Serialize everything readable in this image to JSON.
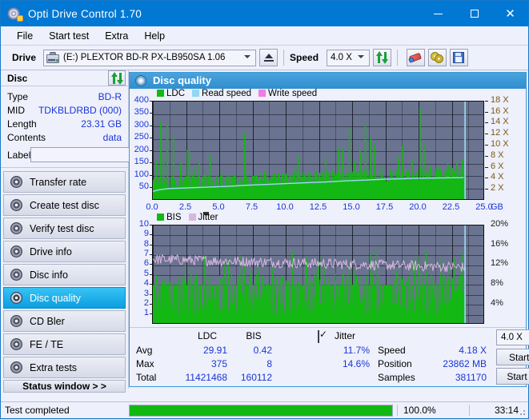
{
  "window": {
    "title": "Opti Drive Control 1.70",
    "icon": "disc-icon",
    "minimize": "–",
    "maximize": "□",
    "close": "✕"
  },
  "menu": [
    {
      "label": "File"
    },
    {
      "label": "Start test"
    },
    {
      "label": "Extra"
    },
    {
      "label": "Help"
    }
  ],
  "toolbar": {
    "drive_label": "Drive",
    "drive_value": "(E:)   PLEXTOR BD-R  PX-LB950SA 1.06",
    "eject_icon": "eject-icon",
    "speed_label": "Speed",
    "speed_value": "4.0 X",
    "icons": [
      "refresh-icon",
      "eraser-icon",
      "discs-icon",
      "save-icon"
    ]
  },
  "disc": {
    "header": "Disc",
    "refresh_icon": "refresh-icon",
    "fields": [
      {
        "key": "Type",
        "value": "BD-R"
      },
      {
        "key": "MID",
        "value": "TDKBLDRBD (000)"
      },
      {
        "key": "Length",
        "value": "23.31 GB"
      },
      {
        "key": "Contents",
        "value": "data"
      }
    ],
    "label_key": "Label",
    "label_value": "",
    "label_placeholder": "",
    "cd_icon": "cd-icon"
  },
  "sidebar": {
    "items": [
      {
        "label": "Transfer rate",
        "selected": false
      },
      {
        "label": "Create test disc",
        "selected": false
      },
      {
        "label": "Verify test disc",
        "selected": false
      },
      {
        "label": "Drive info",
        "selected": false
      },
      {
        "label": "Disc info",
        "selected": false
      },
      {
        "label": "Disc quality",
        "selected": true
      },
      {
        "label": "CD Bler",
        "selected": false
      },
      {
        "label": "FE / TE",
        "selected": false
      },
      {
        "label": "Extra tests",
        "selected": false
      }
    ],
    "status_window": "Status window > >"
  },
  "panel": {
    "title": "Disc quality",
    "icon": "disc-quality-icon"
  },
  "chart_data": [
    {
      "type": "area",
      "title": "LDC",
      "xlabel": "GB",
      "ylabel": "LDC",
      "xlim": [
        0,
        25
      ],
      "ylim": [
        0,
        400
      ],
      "y2lim": [
        0,
        18
      ],
      "y2label": "X",
      "grid": true,
      "legend": [
        "LDC",
        "Read speed",
        "Write speed"
      ],
      "legend_colors": [
        "#14b814",
        "#8fd8f4",
        "#f47ae0"
      ],
      "xticks": [
        "0.0",
        "2.5",
        "5.0",
        "7.5",
        "10.0",
        "12.5",
        "15.0",
        "17.5",
        "20.0",
        "22.5",
        "25.0"
      ],
      "yticks": [
        "50",
        "100",
        "150",
        "200",
        "250",
        "300",
        "350",
        "400"
      ],
      "y2ticks": [
        "2 X",
        "4 X",
        "6 X",
        "8 X",
        "10 X",
        "12 X",
        "14 X",
        "16 X",
        "18 X"
      ],
      "data_end_gb": 23.5,
      "series": [
        {
          "name": "LDC",
          "color": "#14b814",
          "baseline": [
            78,
            72,
            64,
            60,
            58,
            56,
            55,
            54,
            53,
            52,
            52,
            51,
            51,
            50,
            50,
            50,
            50,
            50,
            50,
            51,
            51,
            52,
            52,
            53,
            53,
            54,
            54,
            55,
            55,
            56,
            56,
            57,
            57,
            58,
            58,
            59,
            59,
            60,
            60,
            61,
            61,
            62,
            62,
            63,
            63,
            64,
            64,
            65,
            65,
            66,
            66,
            67,
            67,
            68,
            68,
            69,
            69,
            70,
            70,
            71,
            71,
            72,
            72,
            73,
            73,
            74,
            74,
            75,
            75,
            76,
            76,
            77,
            77,
            78,
            78,
            79,
            79,
            80,
            80,
            81,
            81,
            82,
            82,
            83,
            83,
            84,
            84,
            85,
            85,
            86,
            86,
            87,
            87,
            88,
            88,
            89,
            89,
            90,
            90,
            91
          ],
          "spikes": [
            {
              "x": 0.25,
              "y": 160
            },
            {
              "x": 0.6,
              "y": 320
            },
            {
              "x": 0.8,
              "y": 190
            },
            {
              "x": 1.1,
              "y": 305
            },
            {
              "x": 1.55,
              "y": 260
            },
            {
              "x": 2.1,
              "y": 150
            },
            {
              "x": 2.6,
              "y": 205
            },
            {
              "x": 2.75,
              "y": 200
            },
            {
              "x": 3.1,
              "y": 130
            },
            {
              "x": 3.5,
              "y": 155
            },
            {
              "x": 3.95,
              "y": 110
            },
            {
              "x": 4.3,
              "y": 188
            },
            {
              "x": 5.15,
              "y": 120
            },
            {
              "x": 5.6,
              "y": 95
            },
            {
              "x": 6.2,
              "y": 105
            },
            {
              "x": 6.9,
              "y": 275
            },
            {
              "x": 7.6,
              "y": 100
            },
            {
              "x": 8.4,
              "y": 120
            },
            {
              "x": 9.1,
              "y": 95
            },
            {
              "x": 9.8,
              "y": 110
            },
            {
              "x": 10.6,
              "y": 130
            },
            {
              "x": 11.0,
              "y": 180
            },
            {
              "x": 11.4,
              "y": 105
            },
            {
              "x": 12.3,
              "y": 120
            },
            {
              "x": 13.0,
              "y": 175
            },
            {
              "x": 13.5,
              "y": 125
            },
            {
              "x": 14.0,
              "y": 215
            },
            {
              "x": 14.3,
              "y": 210
            },
            {
              "x": 14.8,
              "y": 295
            },
            {
              "x": 15.2,
              "y": 160
            },
            {
              "x": 15.6,
              "y": 200
            },
            {
              "x": 16.0,
              "y": 310
            },
            {
              "x": 16.4,
              "y": 255
            },
            {
              "x": 16.7,
              "y": 220
            },
            {
              "x": 17.2,
              "y": 145
            },
            {
              "x": 17.9,
              "y": 125
            },
            {
              "x": 18.5,
              "y": 175
            },
            {
              "x": 18.8,
              "y": 220
            },
            {
              "x": 19.5,
              "y": 165
            },
            {
              "x": 20.1,
              "y": 375
            },
            {
              "x": 20.4,
              "y": 225
            },
            {
              "x": 20.9,
              "y": 140
            },
            {
              "x": 21.6,
              "y": 135
            },
            {
              "x": 22.2,
              "y": 150
            },
            {
              "x": 22.9,
              "y": 155
            },
            {
              "x": 23.3,
              "y": 165
            }
          ]
        },
        {
          "name": "Read speed",
          "color": "#9bdcf7",
          "points": [
            [
              0,
              1.7
            ],
            [
              0.5,
              2.0
            ],
            [
              1.2,
              2.2
            ],
            [
              2.3,
              2.3
            ],
            [
              3.3,
              2.4
            ],
            [
              4.4,
              2.5
            ],
            [
              5.6,
              2.6
            ],
            [
              7.0,
              2.8
            ],
            [
              8.5,
              2.95
            ],
            [
              10.0,
              3.1
            ],
            [
              11.5,
              3.25
            ],
            [
              13.0,
              3.4
            ],
            [
              14.5,
              3.6
            ],
            [
              16.0,
              3.75
            ],
            [
              17.5,
              3.9
            ],
            [
              19.0,
              4.0
            ],
            [
              20.5,
              4.1
            ],
            [
              22.0,
              4.15
            ],
            [
              23.4,
              4.18
            ]
          ]
        }
      ]
    },
    {
      "type": "area",
      "title": "BIS",
      "xlabel": "GB",
      "ylabel": "BIS",
      "xlim": [
        0,
        25
      ],
      "ylim": [
        0,
        10
      ],
      "y2lim": [
        0,
        20
      ],
      "y2label": "%",
      "grid": true,
      "legend": [
        "BIS",
        "Jitter"
      ],
      "legend_colors": [
        "#14b814",
        "#d8b6e0"
      ],
      "xticks": [
        "0.0",
        "2.5",
        "5.0",
        "7.5",
        "10.0",
        "12.5",
        "15.0",
        "17.5",
        "20.0",
        "22.5",
        "25.0"
      ],
      "yticks": [
        "1",
        "2",
        "3",
        "4",
        "5",
        "6",
        "7",
        "8",
        "9",
        "10"
      ],
      "y2ticks": [
        "4%",
        "8%",
        "12%",
        "16%",
        "20%"
      ],
      "data_end_gb": 23.5,
      "series": [
        {
          "name": "BIS",
          "color": "#14b814",
          "baseline_level": 4.0,
          "max": 8
        },
        {
          "name": "Jitter",
          "color": "#d8b6e0",
          "avg_pct": 11.7,
          "max_pct": 14.6,
          "level_start": 6.6,
          "level_end": 5.8
        }
      ]
    }
  ],
  "results": {
    "col_headers": [
      "LDC",
      "BIS"
    ],
    "row_headers": [
      "Avg",
      "Max",
      "Total"
    ],
    "ldc": {
      "avg": "29.91",
      "max": "375",
      "total": "11421468"
    },
    "bis": {
      "avg": "0.42",
      "max": "8",
      "total": "160112"
    },
    "jitter_label": "Jitter",
    "jitter_checked": true,
    "jitter_avg": "11.7%",
    "jitter_max": "14.6%",
    "speed_label": "Speed",
    "speed_value": "4.18 X",
    "position_label": "Position",
    "position_value": "23862 MB",
    "samples_label": "Samples",
    "samples_value": "381170",
    "speed_select": "4.0 X",
    "start_full": "Start full",
    "start_part": "Start part"
  },
  "statusbar": {
    "message": "Test completed",
    "progress_pct": "100.0%",
    "progress_value": 100,
    "elapsed": "33:14"
  }
}
